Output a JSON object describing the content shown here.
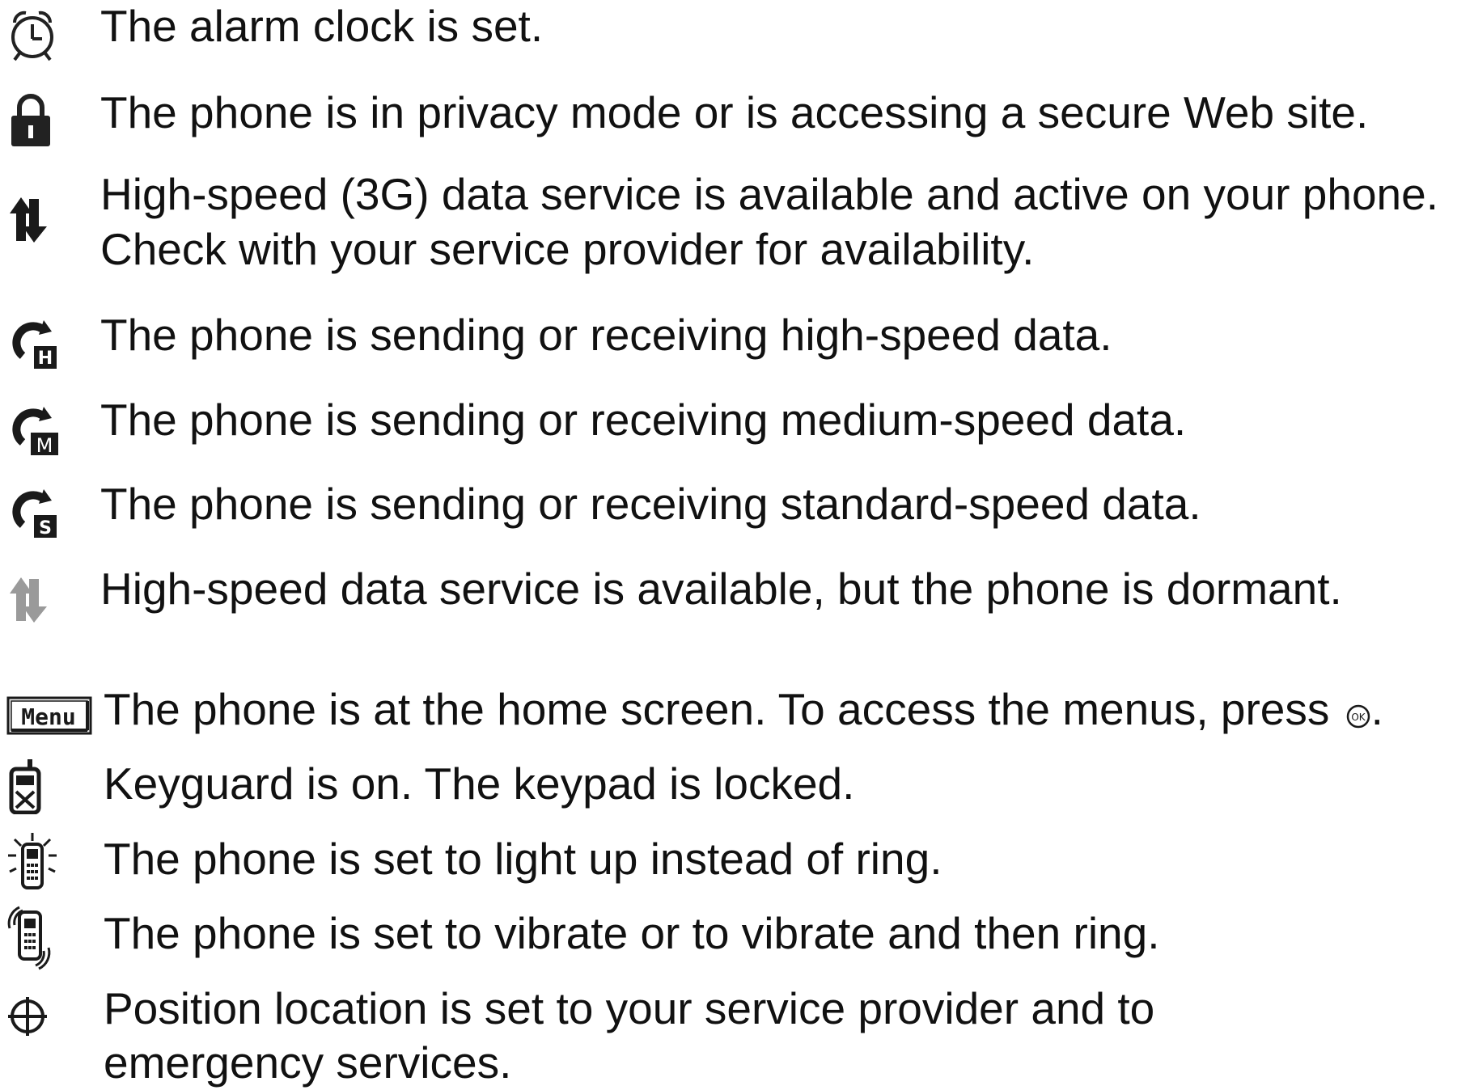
{
  "legend": {
    "items": [
      {
        "icon": "alarm-clock-icon",
        "text": "The alarm clock is set."
      },
      {
        "icon": "padlock-icon",
        "text": "The phone is in privacy mode or is accessing a secure Web site."
      },
      {
        "icon": "3g-data-active-icon",
        "text": "High-speed (3G) data service is available and active on your phone.",
        "text2": "Check with your service provider for availability."
      },
      {
        "icon": "data-high-speed-icon",
        "badge": "H",
        "text": "The phone is sending or receiving high-speed data."
      },
      {
        "icon": "data-medium-speed-icon",
        "badge": "M",
        "text": "The phone is sending or receiving medium-speed data."
      },
      {
        "icon": "data-standard-speed-icon",
        "badge": "S",
        "text": "The phone is sending or receiving standard-speed data."
      },
      {
        "icon": "3g-data-dormant-icon",
        "text": "High-speed data service is available, but the phone is dormant."
      },
      {
        "icon": "menu-softkey-icon",
        "badge": "Menu",
        "text": "The phone is at the home screen. To access the menus, press",
        "text_after": ".",
        "inline_icon": "ok-key-icon",
        "inline_label": "OK"
      },
      {
        "icon": "keyguard-icon",
        "text": "Keyguard is on. The keypad is locked."
      },
      {
        "icon": "light-up-phone-icon",
        "text": "The phone is set to light up instead of ring."
      },
      {
        "icon": "vibrate-phone-icon",
        "text": "The phone is set to vibrate or to vibrate and then ring."
      },
      {
        "icon": "position-location-icon",
        "text": "Position location is set to your service provider and to",
        "text2": "emergency services."
      }
    ]
  }
}
